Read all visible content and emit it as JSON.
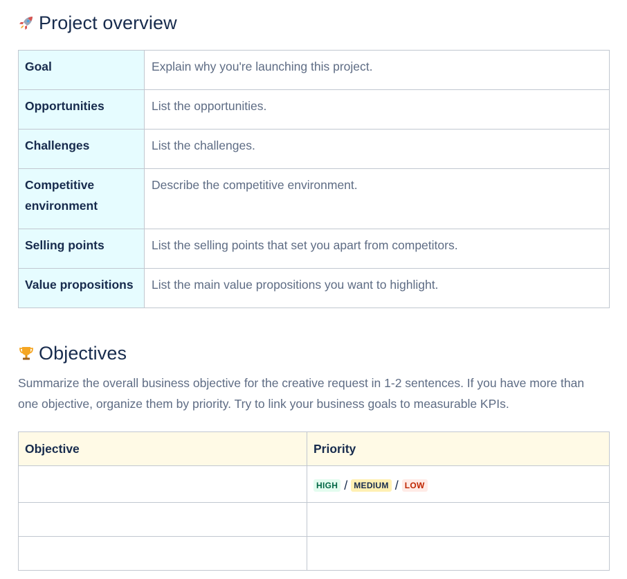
{
  "overview": {
    "title": "Project overview",
    "icon": "rocket-icon",
    "rows": [
      {
        "label": "Goal",
        "value": "Explain why you're launching this project."
      },
      {
        "label": "Opportunities",
        "value": "List the opportunities."
      },
      {
        "label": "Challenges",
        "value": "List the challenges."
      },
      {
        "label": "Competitive environment",
        "value": "Describe the competitive environment."
      },
      {
        "label": "Selling points",
        "value": "List the selling points that set you apart from competitors."
      },
      {
        "label": "Value propositions",
        "value": "List the main value propositions you want to highlight."
      }
    ],
    "label_bg": "#e6fcff"
  },
  "objectives": {
    "title": "Objectives",
    "icon": "trophy-icon",
    "description": "Summarize the overall business objective for the creative request in 1-2 sentences. If you have more than one objective, organize them by priority. Try to link your business goals to measurable KPIs.",
    "table": {
      "headers": [
        "Objective",
        "Priority"
      ],
      "header_bg": "#fffae6",
      "rows": [
        {
          "objective": "",
          "priority": {
            "high": "HIGH",
            "separator1": "/",
            "medium": "MEDIUM",
            "separator2": "/",
            "low": "LOW"
          }
        },
        {
          "objective": "",
          "priority": ""
        },
        {
          "objective": "",
          "priority": ""
        }
      ]
    }
  },
  "colors": {
    "text_primary": "#172b4d",
    "text_secondary": "#5e6c84",
    "border": "#c1c7d0",
    "status_high_bg": "#e3fcef",
    "status_high_text": "#006644",
    "status_medium_bg": "#fff0b3",
    "status_low_bg": "#ffebe6",
    "status_low_text": "#bf2600"
  }
}
